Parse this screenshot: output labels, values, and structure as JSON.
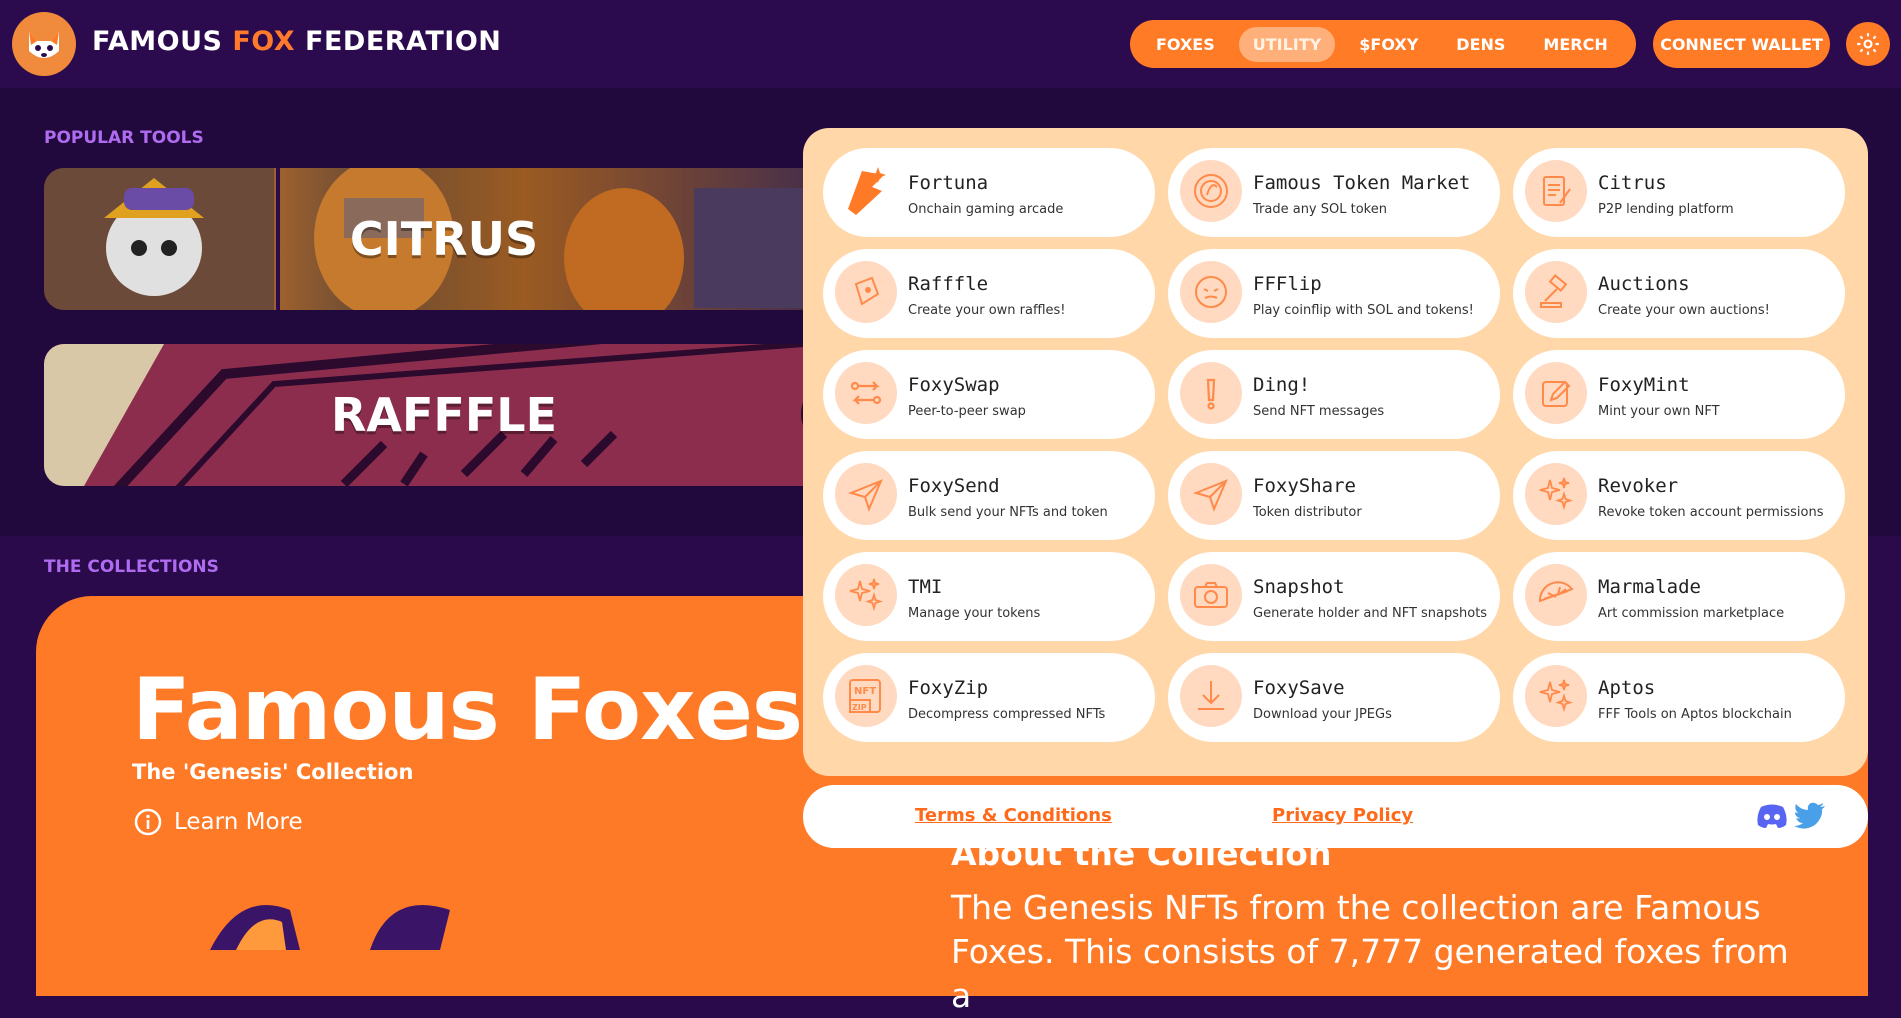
{
  "brand": {
    "part1": "FAMOUS",
    "part2": "FOX",
    "part3": "FEDERATION"
  },
  "nav": {
    "items": [
      "FOXES",
      "UTILITY",
      "$FOXY",
      "DENS",
      "MERCH"
    ],
    "active": "UTILITY",
    "connect": "CONNECT WALLET"
  },
  "popular": {
    "label": "POPULAR TOOLS",
    "banners": [
      "CITRUS",
      "RAFFFLE"
    ]
  },
  "collections": {
    "label": "THE COLLECTIONS",
    "title": "Famous Foxes",
    "subtitle": "The 'Genesis' Collection",
    "learn_more": "Learn More",
    "about_title": "About the Collection",
    "about_text": "The Genesis NFTs from the collection are Famous Foxes. This consists of 7,777 generated foxes from a"
  },
  "tools": [
    {
      "name": "Fortuna",
      "desc": "Onchain gaming arcade",
      "icon": "fortuna-icon"
    },
    {
      "name": "Famous Token Market",
      "desc": "Trade any SOL token",
      "icon": "token-market-icon"
    },
    {
      "name": "Citrus",
      "desc": "P2P lending platform",
      "icon": "document-icon"
    },
    {
      "name": "Rafffle",
      "desc": "Create your own raffles!",
      "icon": "ticket-icon"
    },
    {
      "name": "FFFlip",
      "desc": "Play coinflip with SOL and tokens!",
      "icon": "coin-icon"
    },
    {
      "name": "Auctions",
      "desc": "Create your own auctions!",
      "icon": "gavel-icon"
    },
    {
      "name": "FoxySwap",
      "desc": "Peer-to-peer swap",
      "icon": "swap-icon"
    },
    {
      "name": "Ding!",
      "desc": "Send NFT messages",
      "icon": "exclamation-icon"
    },
    {
      "name": "FoxyMint",
      "desc": "Mint your own NFT",
      "icon": "edit-icon"
    },
    {
      "name": "FoxySend",
      "desc": "Bulk send your NFTs and token",
      "icon": "send-icon"
    },
    {
      "name": "FoxyShare",
      "desc": "Token distributor",
      "icon": "send-icon"
    },
    {
      "name": "Revoker",
      "desc": "Revoke token account permissions",
      "icon": "sparkle-icon"
    },
    {
      "name": "TMI",
      "desc": "Manage your tokens",
      "icon": "sparkle-icon"
    },
    {
      "name": "Snapshot",
      "desc": "Generate holder and NFT snapshots",
      "icon": "camera-icon"
    },
    {
      "name": "Marmalade",
      "desc": "Art commission marketplace",
      "icon": "orange-slice-icon"
    },
    {
      "name": "FoxyZip",
      "desc": "Decompress compressed NFTs",
      "icon": "nft-zip-icon"
    },
    {
      "name": "FoxySave",
      "desc": "Download your JPEGs",
      "icon": "download-icon"
    },
    {
      "name": "Aptos",
      "desc": "FFF Tools on Aptos blockchain",
      "icon": "sparkle-icon"
    }
  ],
  "footer": {
    "terms": "Terms & Conditions",
    "privacy": "Privacy Policy"
  },
  "colors": {
    "accent": "#ff7a26",
    "background": "#2a0a4a",
    "dropdown": "#ffd7a8"
  }
}
